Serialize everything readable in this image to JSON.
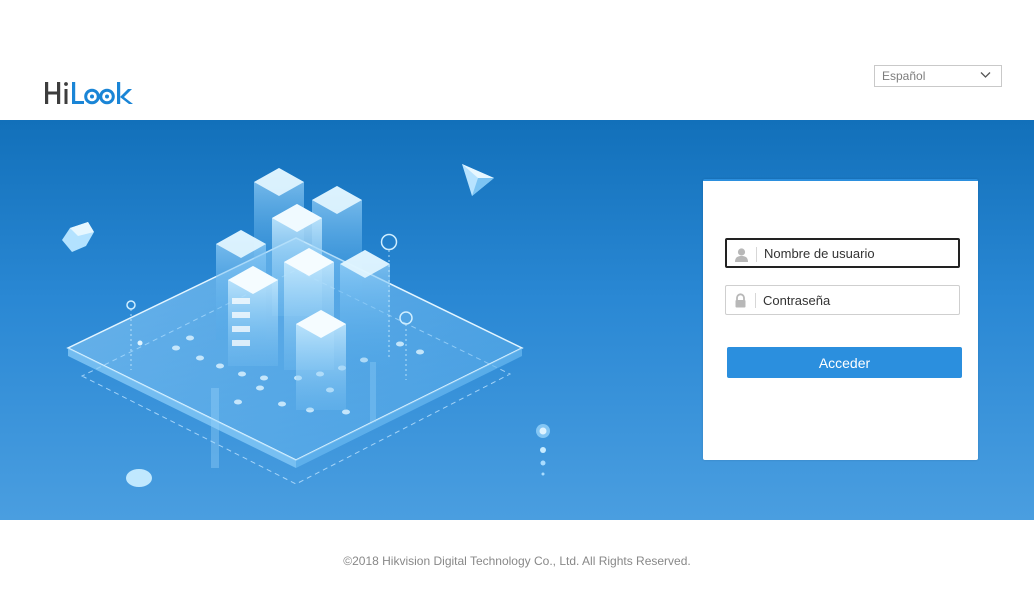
{
  "brand": {
    "logo_text": "HiLook"
  },
  "header": {
    "language": {
      "selected": "Español",
      "icon": "chevron-down-icon"
    }
  },
  "login": {
    "username": {
      "placeholder": "Nombre de usuario",
      "value": "",
      "icon": "user-icon"
    },
    "password": {
      "placeholder": "Contraseña",
      "value": "",
      "icon": "lock-icon"
    },
    "submit_label": "Acceder"
  },
  "footer": {
    "copyright": "©2018 Hikvision Digital Technology Co., Ltd. All Rights Reserved."
  },
  "colors": {
    "brand_blue": "#2b8fde",
    "banner_top": "#1270ba",
    "banner_bottom": "#4a9ee0",
    "logo_gray": "#3d3d3d"
  }
}
